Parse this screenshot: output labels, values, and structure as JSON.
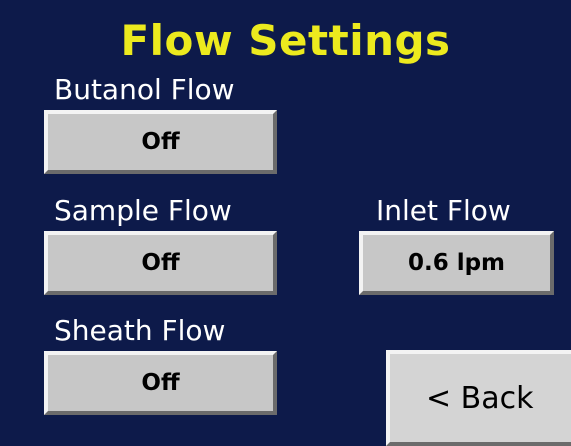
{
  "screen": {
    "title": "Flow Settings"
  },
  "butanol_flow": {
    "label": "Butanol Flow",
    "value": "Off"
  },
  "sample_flow": {
    "label": "Sample Flow",
    "value": "Off"
  },
  "inlet_flow": {
    "label": "Inlet Flow",
    "value": "0.6 lpm"
  },
  "sheath_flow": {
    "label": "Sheath Flow",
    "value": "Off"
  },
  "navigation": {
    "back_label": "< Back"
  },
  "colors": {
    "background": "#0d1a4a",
    "title": "#ecea1e",
    "label": "#ffffff",
    "button_face": "#c7c7c7"
  }
}
